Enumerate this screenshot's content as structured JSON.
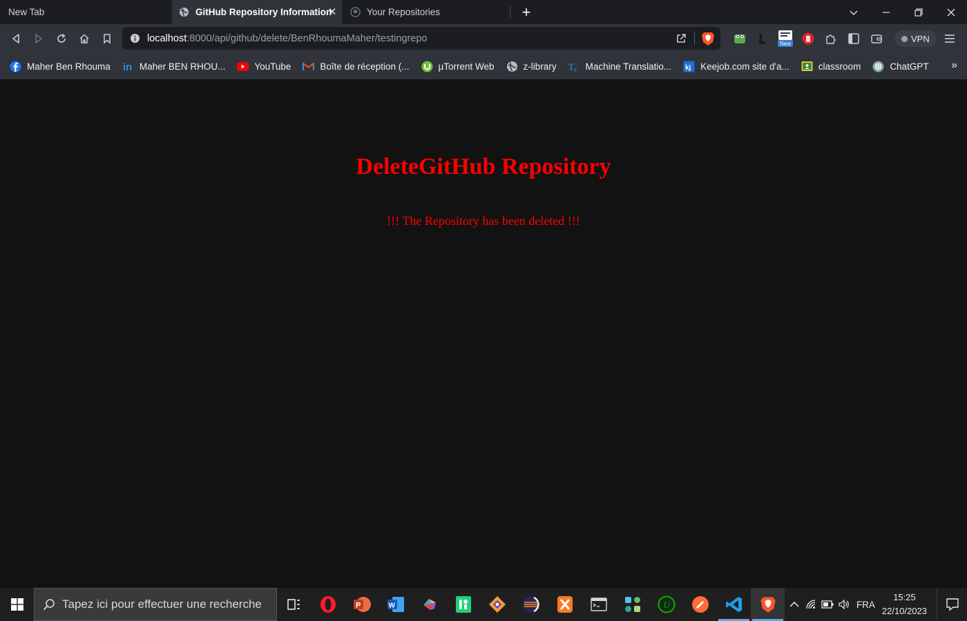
{
  "tabs": [
    {
      "title": "New Tab"
    },
    {
      "title": "GitHub Repository Information"
    },
    {
      "title": "Your Repositories"
    }
  ],
  "address_bar": {
    "host": "localhost",
    "path": ":8000/api/github/delete/BenRhoumaMaher/testingrepo"
  },
  "vpn_label": "VPN",
  "bookmarks": [
    {
      "label": "Maher Ben Rhouma",
      "icon": "facebook-icon"
    },
    {
      "label": "Maher BEN RHOU...",
      "icon": "linkedin-icon"
    },
    {
      "label": "YouTube",
      "icon": "youtube-icon"
    },
    {
      "label": "Boîte de réception (...",
      "icon": "gmail-icon"
    },
    {
      "label": "µTorrent Web",
      "icon": "utorrent-icon"
    },
    {
      "label": "z-library",
      "icon": "zlibrary-icon"
    },
    {
      "label": "Machine Translatio...",
      "icon": "translate-icon"
    },
    {
      "label": "Keejob.com site d'a...",
      "icon": "keejob-icon"
    },
    {
      "label": "classroom",
      "icon": "classroom-icon"
    },
    {
      "label": "ChatGPT",
      "icon": "chatgpt-icon"
    }
  ],
  "page": {
    "title": "DeleteGitHub Repository",
    "message": "!!! The Repository has been deleted !!!"
  },
  "taskbar": {
    "search_placeholder": "Tapez ici pour effectuer une recherche",
    "language": "FRA",
    "time": "15:25",
    "date": "22/10/2023"
  },
  "colors": {
    "page_text": "#ff0000",
    "page_background": "#121212",
    "taskbar_active_indicator": "#6aa5e8"
  }
}
